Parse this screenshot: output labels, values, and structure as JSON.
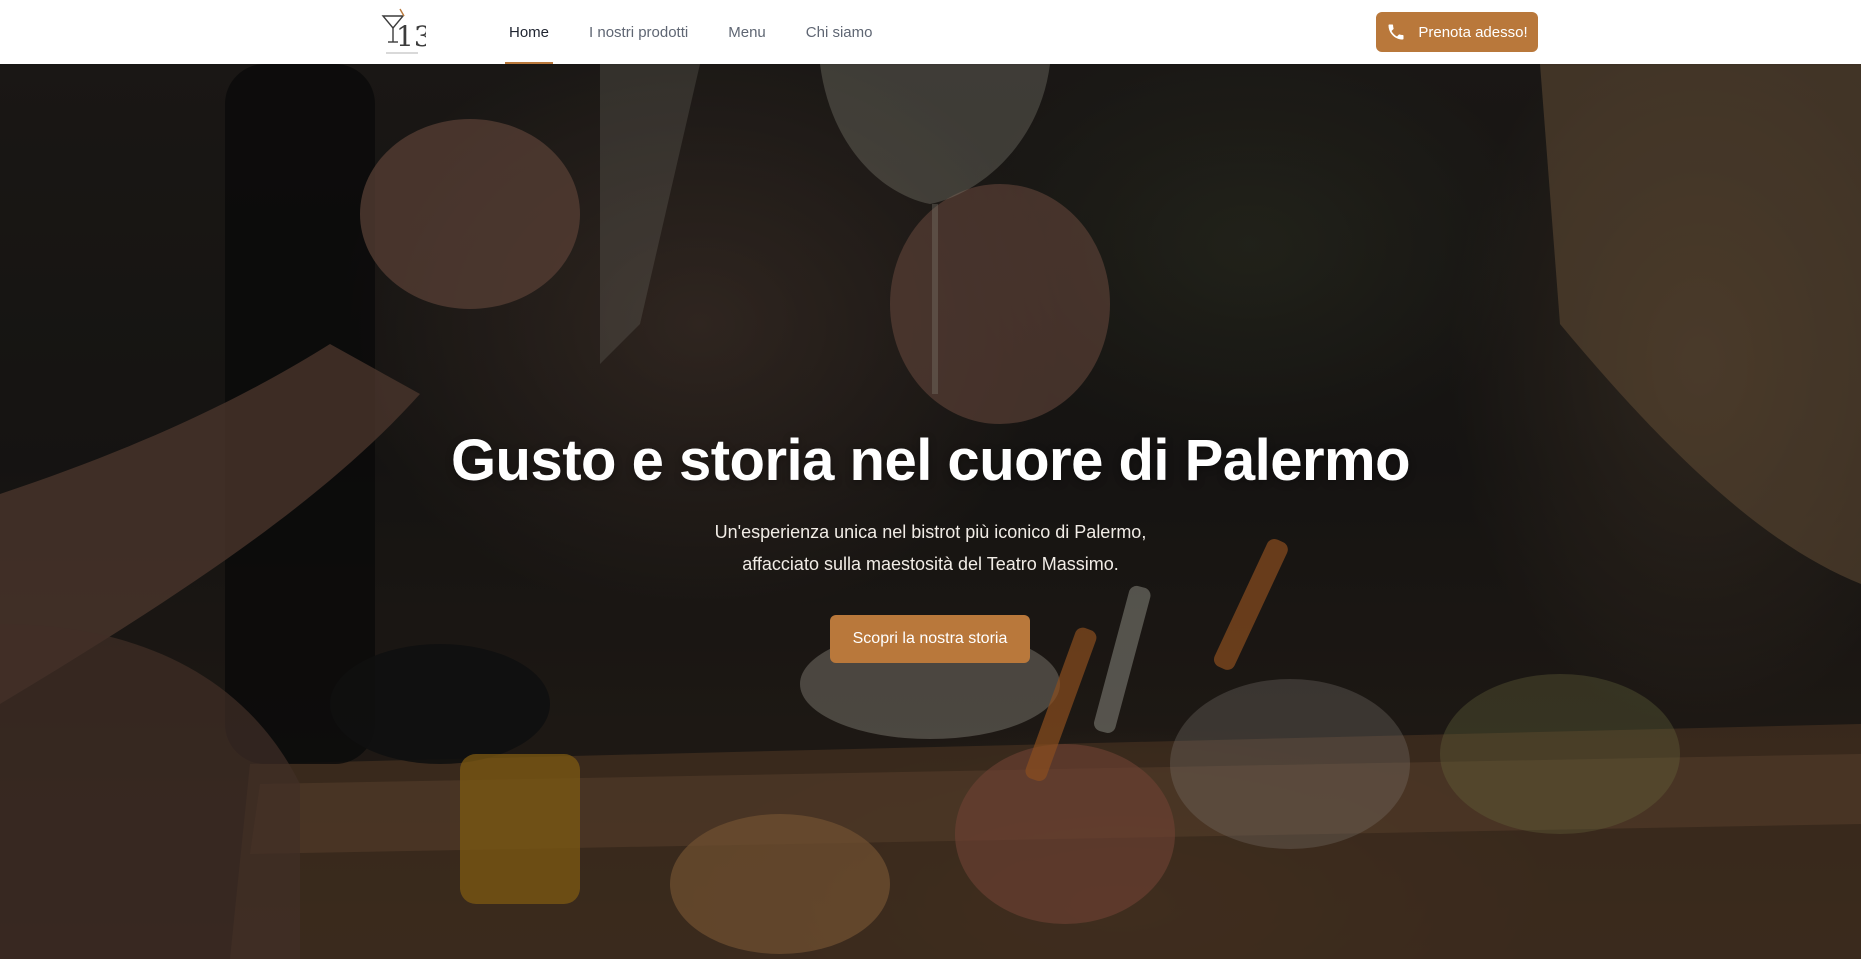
{
  "header": {
    "logo_alt": "13 logo",
    "nav": [
      {
        "label": "Home",
        "active": true
      },
      {
        "label": "I nostri prodotti",
        "active": false
      },
      {
        "label": "Menu",
        "active": false
      },
      {
        "label": "Chi siamo",
        "active": false
      }
    ],
    "cta_label": "Prenota adesso!",
    "cta_icon": "phone-icon"
  },
  "hero": {
    "title": "Gusto e storia nel cuore di Palermo",
    "subtitle_line1": "Un'esperienza unica nel bistrot più iconico di Palermo,",
    "subtitle_line2": "affacciato sulla maestosità del Teatro Massimo.",
    "button_label": "Scopri la nostra storia",
    "background_image": "photo of two people toasting with wine glasses over a board of appetizers"
  },
  "colors": {
    "accent": "#b9783b",
    "nav_active": "#1f2430",
    "nav_inactive": "#5f6673",
    "header_bg": "#ffffff"
  }
}
